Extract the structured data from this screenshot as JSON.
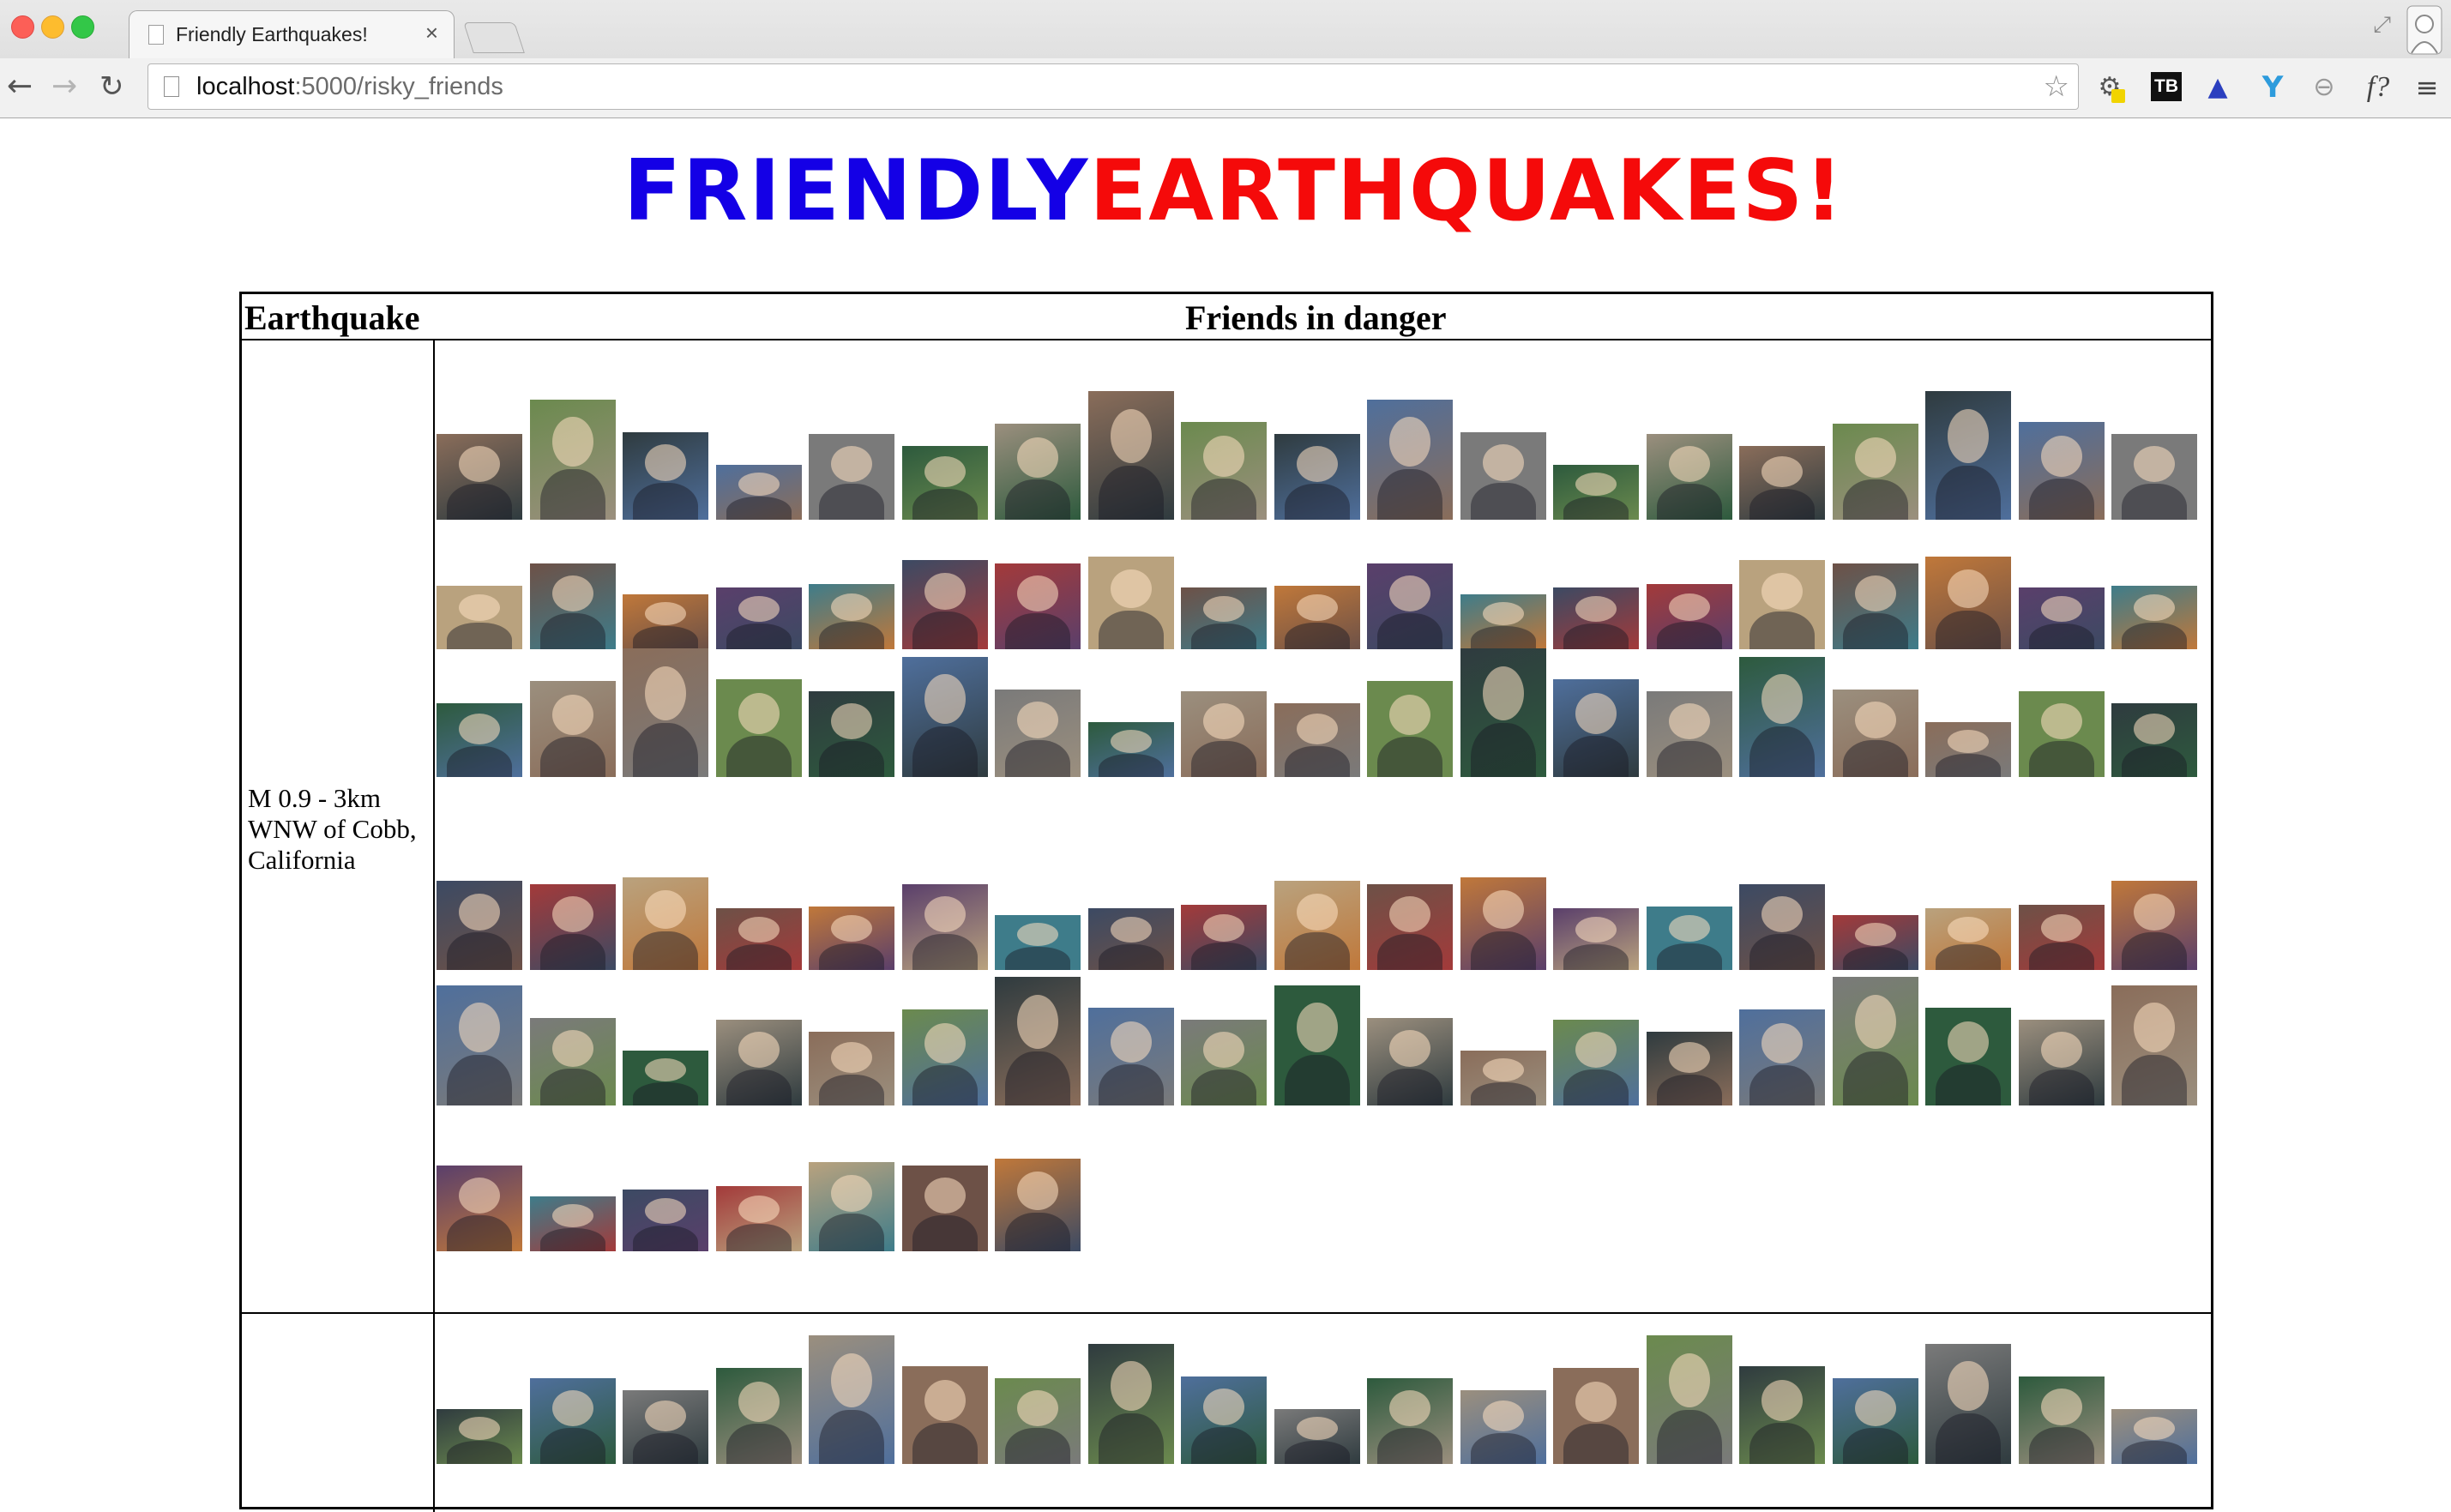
{
  "browser": {
    "tab_title": "Friendly Earthquakes!",
    "tab_close": "×",
    "url_host": "localhost",
    "url_rest": ":5000/risky_friends",
    "back_glyph": "←",
    "forward_glyph": "→",
    "reload_glyph": "↻",
    "star_glyph": "☆",
    "expand_glyph": "⤢",
    "extensions": [
      {
        "name": "puzzle-extension-icon",
        "glyph": "⚙"
      },
      {
        "name": "tb-extension-icon",
        "glyph": "TB"
      },
      {
        "name": "map-extension-icon",
        "glyph": "▲"
      },
      {
        "name": "y-extension-icon",
        "glyph": "Y"
      },
      {
        "name": "block-extension-icon",
        "glyph": "⊖"
      },
      {
        "name": "fquery-extension-icon",
        "glyph": "f?"
      },
      {
        "name": "menu-icon",
        "glyph": "≡"
      }
    ]
  },
  "page": {
    "logo_part1": "FRIENDLY",
    "logo_part2": "EARTHQUAKES!",
    "logo_colors": {
      "part1": "#1400e6",
      "part2": "#f50a0a"
    },
    "table": {
      "col_earthquake": "Earthquake",
      "col_friends": "Friends in danger",
      "rows": [
        {
          "earthquake": "M 0.9 - 3km WNW of Cobb, California",
          "friend_photos": 102
        },
        {
          "earthquake": "",
          "friend_photos": 19
        }
      ]
    }
  }
}
